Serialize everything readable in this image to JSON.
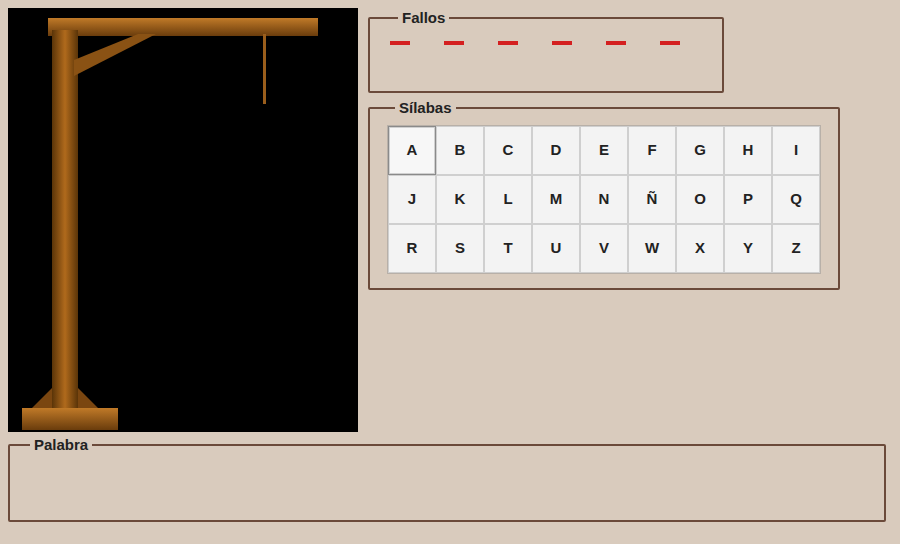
{
  "fallos": {
    "label": "Fallos",
    "slots": [
      {
        "filled": false
      },
      {
        "filled": false
      },
      {
        "filled": false
      },
      {
        "filled": false
      },
      {
        "filled": false
      },
      {
        "filled": false
      }
    ]
  },
  "silabas": {
    "label": "Sílabas",
    "keys": [
      {
        "label": "A",
        "focused": true
      },
      {
        "label": "B",
        "focused": false
      },
      {
        "label": "C",
        "focused": false
      },
      {
        "label": "D",
        "focused": false
      },
      {
        "label": "E",
        "focused": false
      },
      {
        "label": "F",
        "focused": false
      },
      {
        "label": "G",
        "focused": false
      },
      {
        "label": "H",
        "focused": false
      },
      {
        "label": "I",
        "focused": false
      },
      {
        "label": "J",
        "focused": false
      },
      {
        "label": "K",
        "focused": false
      },
      {
        "label": "L",
        "focused": false
      },
      {
        "label": "M",
        "focused": false
      },
      {
        "label": "N",
        "focused": false
      },
      {
        "label": "Ñ",
        "focused": false
      },
      {
        "label": "O",
        "focused": false
      },
      {
        "label": "P",
        "focused": false
      },
      {
        "label": "Q",
        "focused": false
      },
      {
        "label": "R",
        "focused": false
      },
      {
        "label": "S",
        "focused": false
      },
      {
        "label": "T",
        "focused": false
      },
      {
        "label": "U",
        "focused": false
      },
      {
        "label": "V",
        "focused": false
      },
      {
        "label": "W",
        "focused": false
      },
      {
        "label": "X",
        "focused": false
      },
      {
        "label": "Y",
        "focused": false
      },
      {
        "label": "Z",
        "focused": false
      }
    ]
  },
  "palabra": {
    "label": "Palabra"
  }
}
